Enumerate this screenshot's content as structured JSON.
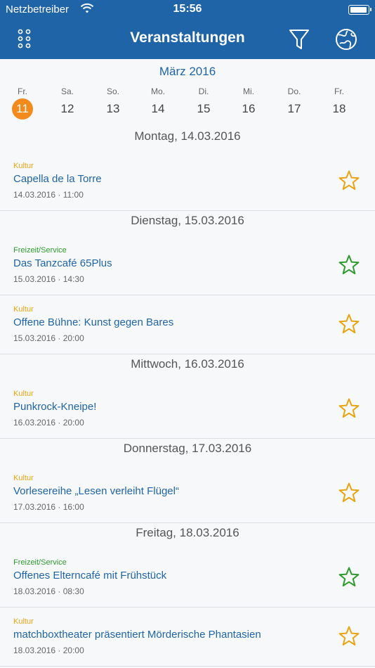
{
  "status_bar": {
    "carrier": "Netzbetreiber",
    "time": "15:56"
  },
  "navbar": {
    "title": "Veranstaltungen"
  },
  "calendar": {
    "month": "März 2016",
    "days": [
      {
        "name": "Fr.",
        "num": "11",
        "selected": true
      },
      {
        "name": "Sa.",
        "num": "12"
      },
      {
        "name": "So.",
        "num": "13"
      },
      {
        "name": "Mo.",
        "num": "14"
      },
      {
        "name": "Di.",
        "num": "15"
      },
      {
        "name": "Mi.",
        "num": "16"
      },
      {
        "name": "Do.",
        "num": "17"
      },
      {
        "name": "Fr.",
        "num": "18"
      }
    ]
  },
  "colors": {
    "brand": "#1f64a6",
    "kultur": "#e8a412",
    "freizeit": "#2e9a2e",
    "selected_day": "#f28b1c"
  },
  "sections": [
    {
      "header": "Montag, 14.03.2016",
      "events": [
        {
          "category": "Kultur",
          "type": "kultur",
          "title": "Capella de la Torre",
          "date": "14.03.2016 · 11:00"
        }
      ]
    },
    {
      "header": "Dienstag, 15.03.2016",
      "events": [
        {
          "category": "Freizeit/Service",
          "type": "freizeit",
          "title": "Das Tanzcafé 65Plus",
          "date": "15.03.2016 · 14:30"
        },
        {
          "category": "Kultur",
          "type": "kultur",
          "title": "Offene Bühne: Kunst gegen Bares",
          "date": "15.03.2016 · 20:00"
        }
      ]
    },
    {
      "header": "Mittwoch, 16.03.2016",
      "events": [
        {
          "category": "Kultur",
          "type": "kultur",
          "title": "Punkrock-Kneipe!",
          "date": "16.03.2016 · 20:00"
        }
      ]
    },
    {
      "header": "Donnerstag, 17.03.2016",
      "events": [
        {
          "category": "Kultur",
          "type": "kultur",
          "title": "Vorlesereihe „Lesen verleiht Flügel“",
          "date": "17.03.2016 · 16:00"
        }
      ]
    },
    {
      "header": "Freitag, 18.03.2016",
      "events": [
        {
          "category": "Freizeit/Service",
          "type": "freizeit",
          "title": "Offenes Elterncafé mit Frühstück",
          "date": "18.03.2016 · 08:30"
        },
        {
          "category": "Kultur",
          "type": "kultur",
          "title": "matchboxtheater präsentiert Mörderische Phantasien",
          "date": "18.03.2016 · 20:00"
        }
      ]
    }
  ]
}
